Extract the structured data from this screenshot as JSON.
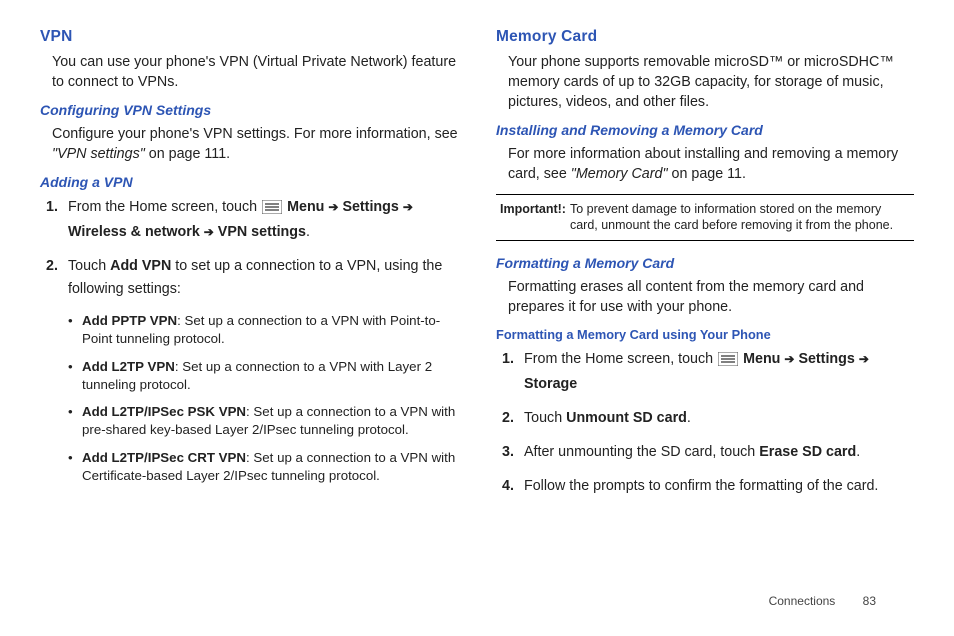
{
  "left": {
    "vpn_heading": "VPN",
    "vpn_intro": "You can use your phone's VPN (Virtual Private Network) feature to connect to VPNs.",
    "config_heading": "Configuring VPN Settings",
    "config_text_a": "Configure your phone's VPN settings. For more information, see ",
    "config_ref": "\"VPN settings\"",
    "config_text_b": " on page 111.",
    "adding_heading": "Adding a VPN",
    "step1_a": "From the Home screen, touch ",
    "step1_menu": " Menu ",
    "step1_settings": " Settings ",
    "step1_wireless": "Wireless & network ",
    "step1_vpn": " VPN settings",
    "step2_a": "Touch ",
    "step2_b": "Add VPN",
    "step2_c": " to set up a connection to a VPN, using the following settings:",
    "bullets": [
      {
        "title": "Add PPTP VPN",
        "desc": ": Set up a connection to a VPN with Point-to-Point tunneling protocol."
      },
      {
        "title": "Add L2TP VPN",
        "desc": ": Set up a connection to a VPN with Layer 2 tunneling protocol."
      },
      {
        "title": "Add L2TP/IPSec PSK VPN",
        "desc": ": Set up a connection to a VPN with pre-shared key-based Layer 2/IPsec tunneling protocol."
      },
      {
        "title": "Add L2TP/IPSec CRT VPN",
        "desc": ": Set up a connection to a VPN with Certificate-based Layer 2/IPsec tunneling protocol."
      }
    ]
  },
  "right": {
    "mem_heading": "Memory Card",
    "mem_intro": "Your phone supports removable microSD™ or microSDHC™ memory cards of up to 32GB capacity, for storage of music, pictures, videos, and other files.",
    "install_heading": "Installing and Removing a Memory Card",
    "install_text_a": "For more information about installing and removing a memory card, see ",
    "install_ref": "\"Memory Card\"",
    "install_text_b": " on page 11.",
    "important_label": "Important!:",
    "important_text": "To prevent damage to information stored on the memory card, unmount the card before removing it from the phone.",
    "format_heading": "Formatting a Memory Card",
    "format_text": "Formatting erases all content from the memory card and prepares it for use with your phone.",
    "format_sub": "Formatting a Memory Card using Your Phone",
    "fstep1_a": "From the Home screen, touch ",
    "fstep1_menu": " Menu ",
    "fstep1_settings": " Settings ",
    "fstep1_storage": "Storage",
    "fstep2_a": "Touch ",
    "fstep2_b": "Unmount SD card",
    "fstep3_a": "After unmounting the SD card, touch ",
    "fstep3_b": "Erase SD card",
    "fstep4": "Follow the prompts to confirm the formatting of the card."
  },
  "footer": {
    "section": "Connections",
    "page": "83"
  },
  "arrow": "➔"
}
